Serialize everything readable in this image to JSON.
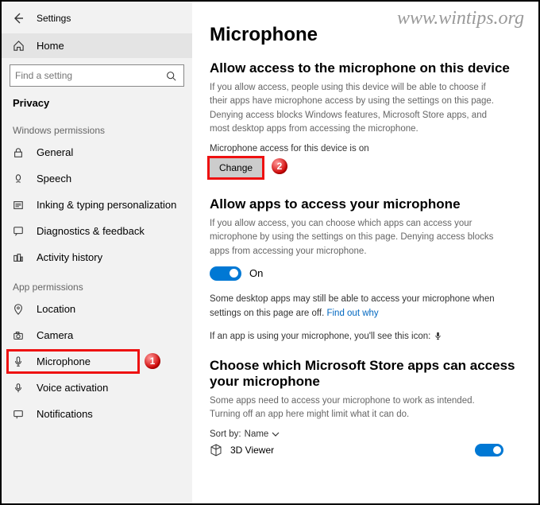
{
  "watermark": "www.wintips.org",
  "window": {
    "title": "Settings"
  },
  "sidebar": {
    "home": "Home",
    "search_placeholder": "Find a setting",
    "category": "Privacy",
    "group1_label": "Windows permissions",
    "group1": [
      {
        "label": "General"
      },
      {
        "label": "Speech"
      },
      {
        "label": "Inking & typing personalization"
      },
      {
        "label": "Diagnostics & feedback"
      },
      {
        "label": "Activity history"
      }
    ],
    "group2_label": "App permissions",
    "group2": [
      {
        "label": "Location"
      },
      {
        "label": "Camera"
      },
      {
        "label": "Microphone"
      },
      {
        "label": "Voice activation"
      },
      {
        "label": "Notifications"
      }
    ]
  },
  "main": {
    "title": "Microphone",
    "section1": {
      "heading": "Allow access to the microphone on this device",
      "desc": "If you allow access, people using this device will be able to choose if their apps have microphone access by using the settings on this page. Denying access blocks Windows features, Microsoft Store apps, and most desktop apps from accessing the microphone.",
      "status": "Microphone access for this device is on",
      "change": "Change"
    },
    "section2": {
      "heading": "Allow apps to access your microphone",
      "desc": "If you allow access, you can choose which apps can access your microphone by using the settings on this page. Denying access blocks apps from accessing your microphone.",
      "toggle": "On",
      "note1": "Some desktop apps may still be able to access your microphone when settings on this page are off. ",
      "note1_link": "Find out why",
      "note2": "If an app is using your microphone, you'll see this icon: "
    },
    "section3": {
      "heading": "Choose which Microsoft Store apps can access your microphone",
      "desc": "Some apps need to access your microphone to work as intended. Turning off an app here might limit what it can do.",
      "sort_label": "Sort by:",
      "sort_value": "Name",
      "apps": [
        {
          "name": "3D Viewer"
        }
      ]
    }
  },
  "annotations": {
    "badge1": "1",
    "badge2": "2"
  }
}
